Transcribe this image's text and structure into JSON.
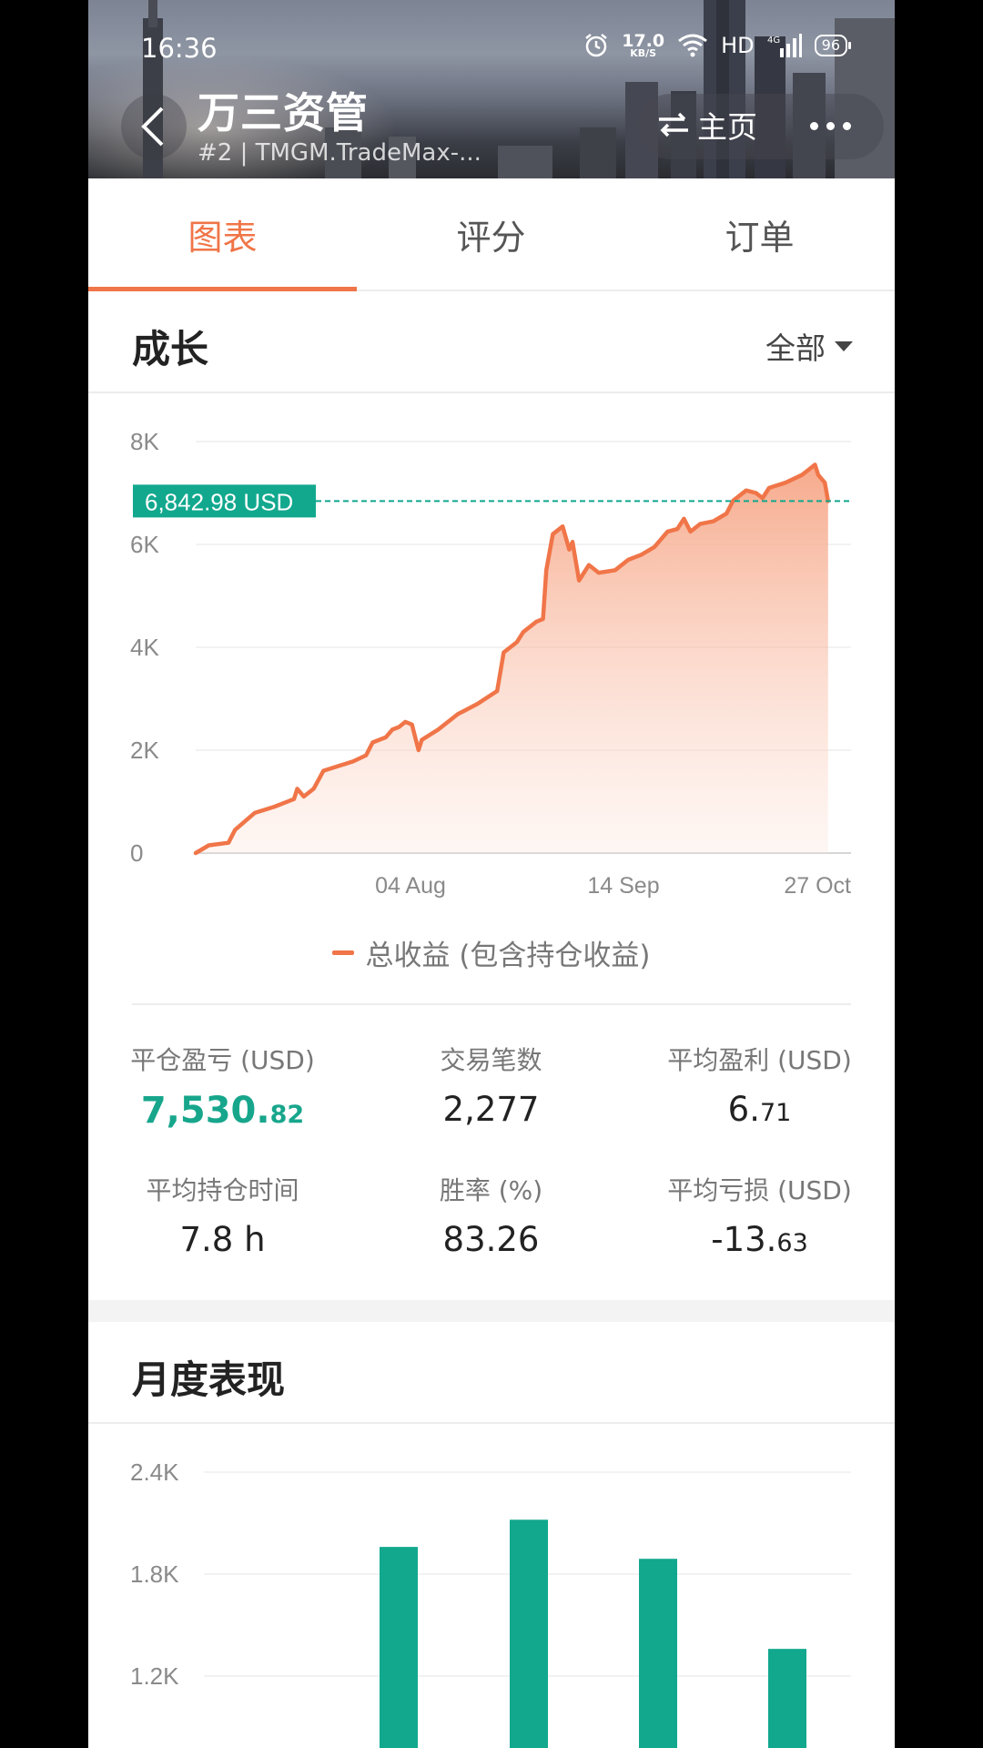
{
  "status_bar": {
    "time": "16:36",
    "net_speed_value": "17.0",
    "net_speed_unit": "KB/S",
    "hd_label": "HD",
    "signal_label": "4G",
    "battery_level": "96"
  },
  "header": {
    "title": "万三资管",
    "subtitle": "#2 | TMGM.TradeMax-...",
    "home_label": "主页"
  },
  "tabs": [
    {
      "label": "图表",
      "active": true
    },
    {
      "label": "评分",
      "active": false
    },
    {
      "label": "订单",
      "active": false
    }
  ],
  "growth": {
    "title": "成长",
    "range_label": "全部",
    "current_value_label": "6,842.98 USD",
    "legend_label": "总收益 (包含持仓收益)"
  },
  "chart_data": [
    {
      "type": "area",
      "title": "",
      "xlabel": "",
      "ylabel": "",
      "ylim": [
        0,
        8000
      ],
      "y_ticks": [
        "0",
        "2K",
        "4K",
        "6K",
        "8K"
      ],
      "x_ticks": [
        "04 Aug",
        "14 Sep",
        "27 Oct"
      ],
      "grid": true,
      "reference_line": 6842.98,
      "series": [
        {
          "name": "总收益 (包含持仓收益)",
          "color": "#f07548",
          "points": [
            [
              0,
              0
            ],
            [
              0.02,
              150
            ],
            [
              0.05,
              200
            ],
            [
              0.06,
              450
            ],
            [
              0.09,
              780
            ],
            [
              0.12,
              900
            ],
            [
              0.15,
              1050
            ],
            [
              0.155,
              1250
            ],
            [
              0.165,
              1100
            ],
            [
              0.18,
              1250
            ],
            [
              0.195,
              1600
            ],
            [
              0.22,
              1700
            ],
            [
              0.24,
              1780
            ],
            [
              0.26,
              1900
            ],
            [
              0.27,
              2150
            ],
            [
              0.29,
              2250
            ],
            [
              0.3,
              2400
            ],
            [
              0.31,
              2450
            ],
            [
              0.32,
              2550
            ],
            [
              0.33,
              2500
            ],
            [
              0.34,
              2000
            ],
            [
              0.345,
              2200
            ],
            [
              0.37,
              2400
            ],
            [
              0.4,
              2700
            ],
            [
              0.43,
              2900
            ],
            [
              0.46,
              3150
            ],
            [
              0.47,
              3900
            ],
            [
              0.49,
              4100
            ],
            [
              0.5,
              4300
            ],
            [
              0.52,
              4500
            ],
            [
              0.53,
              4550
            ],
            [
              0.535,
              5500
            ],
            [
              0.545,
              6200
            ],
            [
              0.56,
              6350
            ],
            [
              0.57,
              5900
            ],
            [
              0.575,
              6050
            ],
            [
              0.585,
              5300
            ],
            [
              0.6,
              5600
            ],
            [
              0.615,
              5450
            ],
            [
              0.64,
              5500
            ],
            [
              0.66,
              5700
            ],
            [
              0.68,
              5800
            ],
            [
              0.7,
              5950
            ],
            [
              0.72,
              6250
            ],
            [
              0.735,
              6300
            ],
            [
              0.745,
              6500
            ],
            [
              0.755,
              6250
            ],
            [
              0.77,
              6400
            ],
            [
              0.79,
              6450
            ],
            [
              0.81,
              6600
            ],
            [
              0.82,
              6850
            ],
            [
              0.84,
              7050
            ],
            [
              0.855,
              7000
            ],
            [
              0.865,
              6900
            ],
            [
              0.875,
              7100
            ],
            [
              0.9,
              7200
            ],
            [
              0.925,
              7350
            ],
            [
              0.935,
              7450
            ],
            [
              0.945,
              7550
            ],
            [
              0.95,
              7350
            ],
            [
              0.96,
              7200
            ],
            [
              0.965,
              6842.98
            ]
          ]
        }
      ]
    },
    {
      "type": "bar",
      "title": "月度表现",
      "ylim": [
        600,
        2400
      ],
      "y_ticks": [
        "2.4K",
        "1.8K",
        "1.2K"
      ],
      "series": [
        {
          "name": "",
          "color": "#11a88e",
          "values": [
            1960,
            2120,
            1890,
            1360
          ]
        }
      ]
    }
  ],
  "stats": [
    {
      "label": "平仓盈亏 (USD)",
      "int": "7,530.",
      "dec": "82",
      "green": true
    },
    {
      "label": "交易笔数",
      "int": "2,277",
      "dec": "",
      "green": false
    },
    {
      "label": "平均盈利 (USD)",
      "int": "6.",
      "dec": "71",
      "green": false
    },
    {
      "label": "平均持仓时间",
      "int": "7.8 h",
      "dec": "",
      "green": false
    },
    {
      "label": "胜率 (%)",
      "int": "83.26",
      "dec": "",
      "green": false
    },
    {
      "label": "平均亏损 (USD)",
      "int": "-13.",
      "dec": "63",
      "green": false
    }
  ],
  "monthly": {
    "title": "月度表现"
  }
}
